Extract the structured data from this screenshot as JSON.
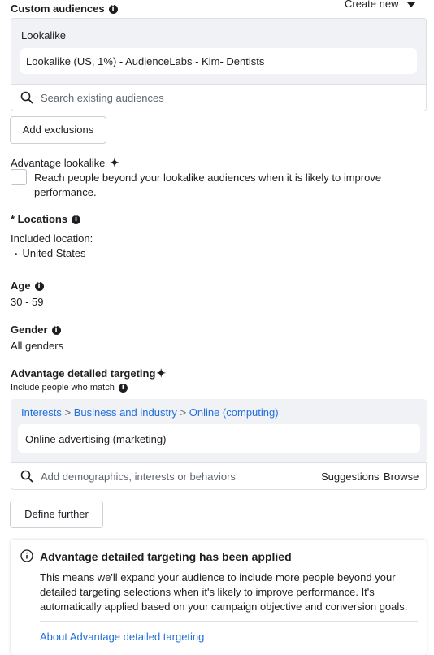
{
  "custom_audiences": {
    "title": "Custom audiences",
    "create_new_label": "Create new",
    "group_label": "Lookalike",
    "selected_audience": "Lookalike (US, 1%) - AudienceLabs - Kim- Dentists",
    "search_placeholder": "Search existing audiences",
    "add_exclusions_label": "Add exclusions"
  },
  "advantage_lookalike": {
    "title": "Advantage lookalike",
    "checkbox_text_line1": "Reach people beyond your lookalike audiences when it is likely to improve",
    "checkbox_text_line2": "performance."
  },
  "locations": {
    "title": "* Locations",
    "included_label": "Included location:",
    "items": [
      "United States"
    ]
  },
  "age": {
    "title": "Age",
    "value": "30 - 59"
  },
  "gender": {
    "title": "Gender",
    "value": "All genders"
  },
  "detailed_targeting": {
    "title": "Advantage detailed targeting",
    "subtitle": "Include people who match",
    "breadcrumb": [
      "Interests",
      "Business and industry",
      "Online (computing)"
    ],
    "breadcrumb_separator": ">",
    "selected_item": "Online advertising (marketing)",
    "search_placeholder": "Add demographics, interests or behaviors",
    "suggestions_label": "Suggestions",
    "browse_label": "Browse",
    "define_further_label": "Define further"
  },
  "notice": {
    "title": "Advantage detailed targeting has been applied",
    "body_line1": "This means we'll expand your audience to include more people beyond your",
    "body_line2": "detailed targeting selections when it's likely to improve performance. It's",
    "body_line3": "automatically applied based on your campaign objective and conversion goals.",
    "link_label": "About Advantage detailed targeting"
  },
  "colors": {
    "link": "#216fdb",
    "text": "#1c1e21",
    "panel_bg": "#f0f2f5",
    "border": "#dddfe2"
  }
}
